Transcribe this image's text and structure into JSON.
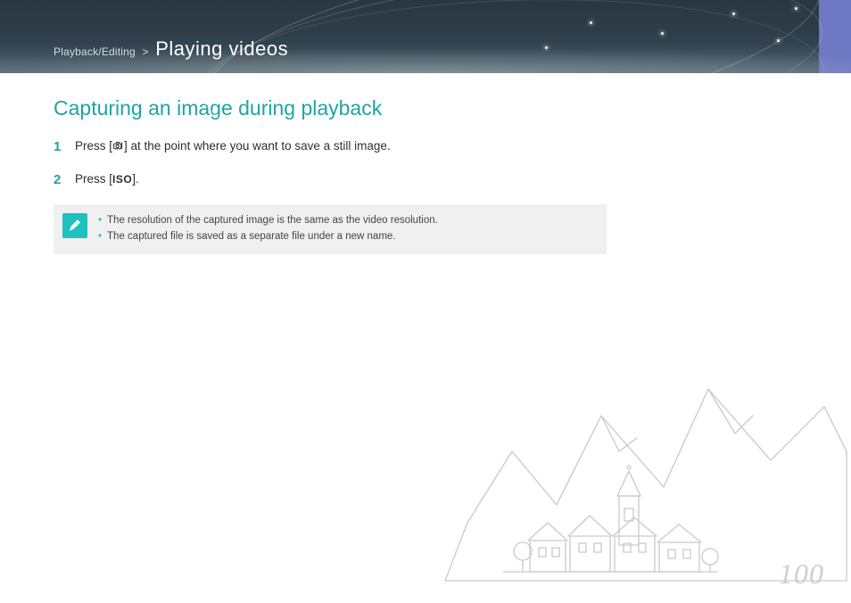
{
  "breadcrumb": {
    "category": "Playback/Editing",
    "separator": ">",
    "title": "Playing videos"
  },
  "heading": "Capturing an image during playback",
  "steps": {
    "one": {
      "num": "1",
      "before": "Press [",
      "after": "] at the point where you want to save a still image.",
      "iconName": "capture-key-icon"
    },
    "two": {
      "num": "2",
      "before": "Press [",
      "after": "].",
      "isoText": "ISO"
    }
  },
  "note": {
    "items": [
      "The resolution of the captured image is the same as the video resolution.",
      "The captured file is saved as a separate file under a new name."
    ]
  },
  "pageNumber": "100"
}
